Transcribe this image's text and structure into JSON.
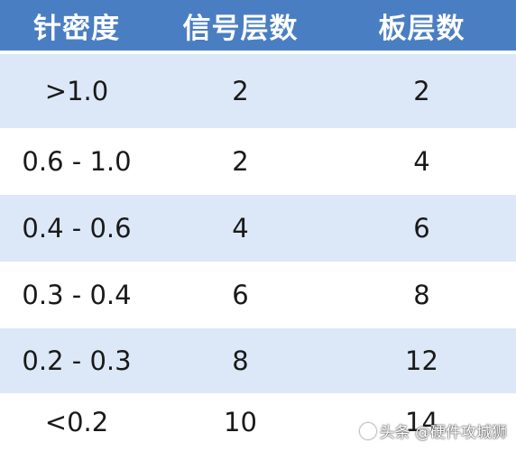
{
  "table": {
    "headers": [
      "针密度",
      "信号层数",
      "板层数"
    ],
    "rows": [
      [
        ">1.0",
        "2",
        "2"
      ],
      [
        "0.6 - 1.0",
        "2",
        "4"
      ],
      [
        "0.4 - 0.6",
        "4",
        "6"
      ],
      [
        "0.3 - 0.4",
        "6",
        "8"
      ],
      [
        "0.2 - 0.3",
        "8",
        "12"
      ],
      [
        "<0.2",
        "10",
        "14"
      ]
    ]
  },
  "watermark": {
    "text": "头条 @硬件攻城狮"
  }
}
